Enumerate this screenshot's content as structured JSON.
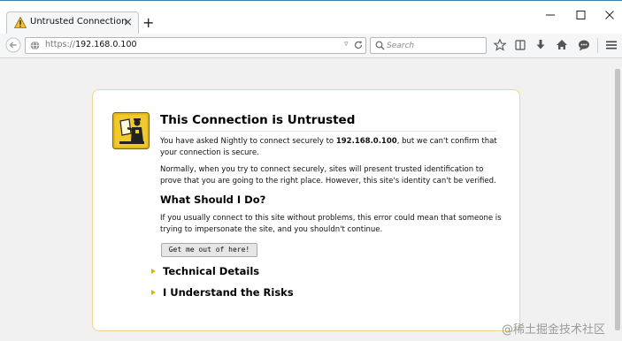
{
  "window": {
    "tab_title": "Untrusted Connection",
    "tab_close": "×",
    "new_tab": "+"
  },
  "navbar": {
    "url_protocol": "https://",
    "url_host": "192.168.0.100",
    "search_placeholder": "Search"
  },
  "error": {
    "title": "This Connection is Untrusted",
    "p1_before": "You have asked Nightly to connect securely to ",
    "p1_host": "192.168.0.100",
    "p1_after": ", but we can't confirm that your connection is secure.",
    "p2": "Normally, when you try to connect securely, sites will present trusted identification to prove that you are going to the right place. However, this site's identity can't be verified.",
    "what_heading": "What Should I Do?",
    "p3": "If you usually connect to this site without problems, this error could mean that someone is trying to impersonate the site, and you shouldn't continue.",
    "escape_button": "Get me out of here!",
    "technical_details": "Technical Details",
    "understand_risks": "I Understand the Risks"
  },
  "watermark": "@稀土掘金技术社区",
  "colors": {
    "accent_border": "#f0d78a",
    "warning_yellow": "#e0b400"
  }
}
